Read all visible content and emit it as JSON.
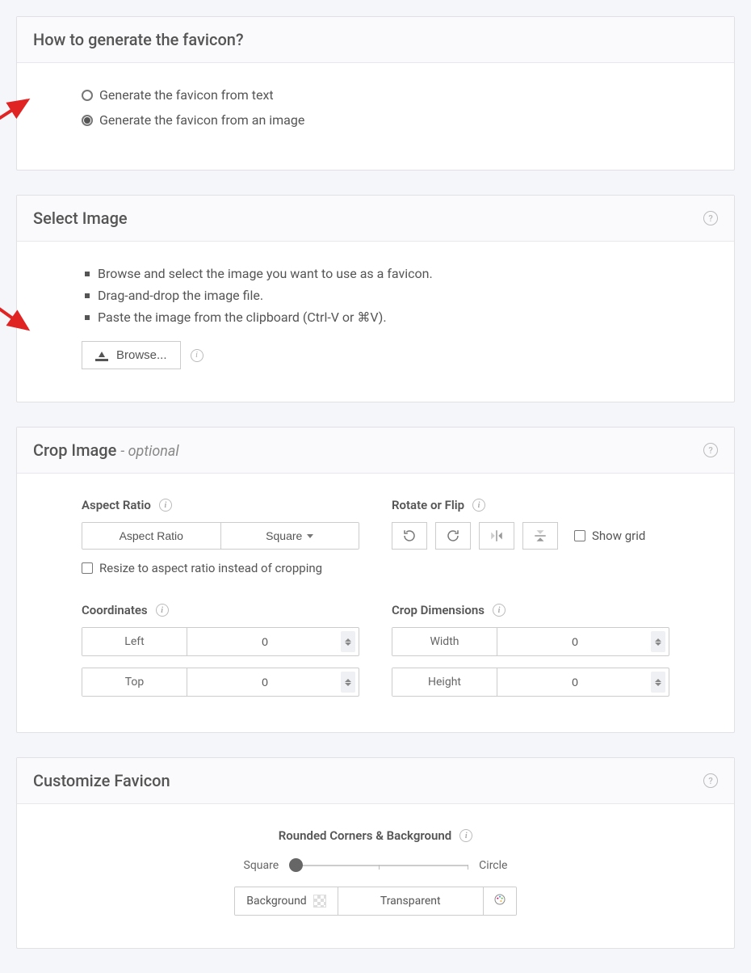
{
  "panel1": {
    "title": "How to generate the favicon?",
    "options": {
      "text": "Generate the favicon from text",
      "image": "Generate the favicon from an image"
    },
    "selected": "image"
  },
  "panel2": {
    "title": "Select Image",
    "bullets": [
      "Browse and select the image you want to use as a favicon.",
      "Drag-and-drop the image file.",
      "Paste the image from the clipboard (Ctrl-V or ⌘V)."
    ],
    "browse": "Browse..."
  },
  "panel3": {
    "title": "Crop Image",
    "optional": "- optional",
    "aspect": {
      "label": "Aspect Ratio",
      "btn1": "Aspect Ratio",
      "btn2": "Square",
      "resize": "Resize to aspect ratio instead of cropping"
    },
    "rotate": {
      "label": "Rotate or Flip",
      "showGrid": "Show grid"
    },
    "coords": {
      "label": "Coordinates",
      "left": {
        "label": "Left",
        "value": "0"
      },
      "top": {
        "label": "Top",
        "value": "0"
      }
    },
    "dims": {
      "label": "Crop Dimensions",
      "width": {
        "label": "Width",
        "value": "0"
      },
      "height": {
        "label": "Height",
        "value": "0"
      }
    }
  },
  "panel4": {
    "title": "Customize Favicon",
    "corners": {
      "label": "Rounded Corners & Background",
      "square": "Square",
      "circle": "Circle",
      "background": "Background",
      "value": "Transparent"
    }
  }
}
